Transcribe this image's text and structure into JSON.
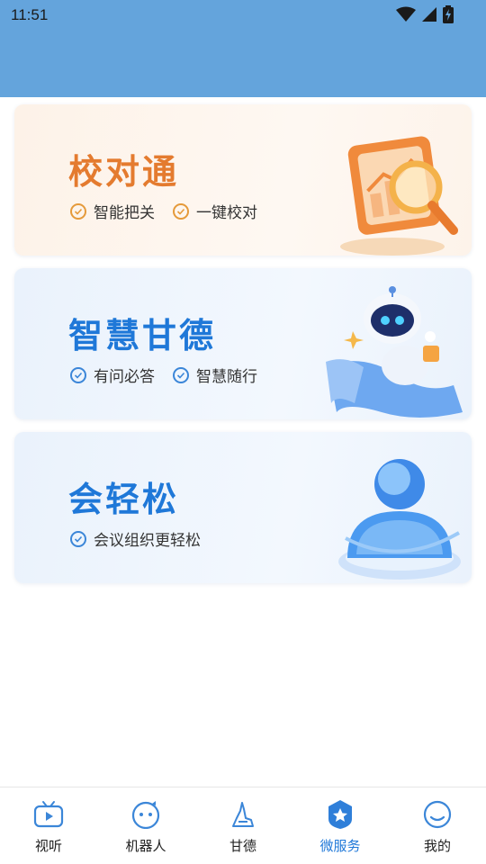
{
  "status": {
    "time": "11:51"
  },
  "cards": [
    {
      "title": "校对通",
      "features": [
        "智能把关",
        "一键校对"
      ],
      "art": "magnifier-chart-icon"
    },
    {
      "title": "智慧甘德",
      "features": [
        "有问必答",
        "智慧随行"
      ],
      "art": "robot-icon"
    },
    {
      "title": "会轻松",
      "features": [
        "会议组织更轻松"
      ],
      "art": "person-icon"
    }
  ],
  "tabs": [
    {
      "label": "视听",
      "icon": "tv-icon"
    },
    {
      "label": "机器人",
      "icon": "robot-face-icon"
    },
    {
      "label": "甘德",
      "icon": "landmark-icon"
    },
    {
      "label": "微服务",
      "icon": "star-badge-icon",
      "active": true
    },
    {
      "label": "我的",
      "icon": "user-icon"
    }
  ],
  "colors": {
    "status_bar": "#64a4dc",
    "accent_blue": "#1f78d8",
    "accent_orange": "#e47b2f"
  }
}
